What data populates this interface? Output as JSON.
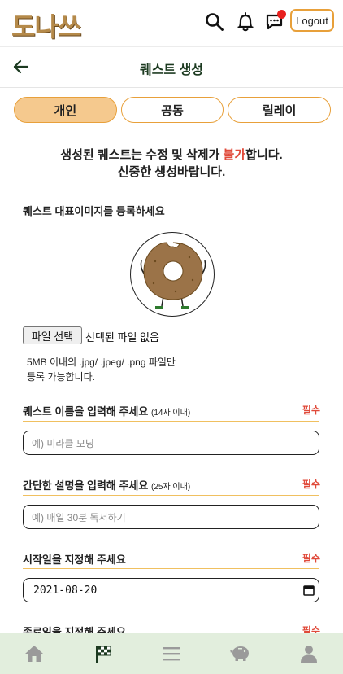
{
  "app": {
    "logo_text": "도나쓰"
  },
  "header": {
    "logout_label": "Logout",
    "icons": [
      "search-icon",
      "bell-icon",
      "chat-icon",
      "chat-notification-dot"
    ]
  },
  "subheader": {
    "title": "퀘스트 생성",
    "back_icon": "back-arrow-icon"
  },
  "tabs": [
    {
      "label": "개인",
      "active": true
    },
    {
      "label": "공동",
      "active": false
    },
    {
      "label": "릴레이",
      "active": false
    }
  ],
  "notice": {
    "line1_before": "생성된 퀘스트는 수정 및 삭제가 ",
    "line1_red": "불가",
    "line1_after": "합니다.",
    "line2": "신중한 생성바랍니다."
  },
  "image_section": {
    "label": "퀘스트 대표이미지를 등록하세요",
    "file_button": "파일 선택",
    "file_status": "선택된 파일 없음",
    "note_line1": "5MB 이내의 .jpg/ .jpeg/ .png 파일만",
    "note_line2": "등록 가능합니다."
  },
  "name_section": {
    "label": "퀘스트 이름을 입력해 주세요",
    "hint": "(14자 이내)",
    "required": "필수",
    "placeholder": "예) 미라클 모닝"
  },
  "desc_section": {
    "label": "간단한 설명을 입력해 주세요",
    "hint": "(25자 이내)",
    "required": "필수",
    "placeholder": "예) 매일 30분 독서하기"
  },
  "start_section": {
    "label": "시작일을 지정해 주세요",
    "required": "필수",
    "value": "2021-08-20"
  },
  "end_section": {
    "label": "종료일을 지정해 주세요",
    "required": "필수"
  },
  "bottom_nav": [
    "home-icon",
    "checkered-flag-icon",
    "menu-icon",
    "piggy-bank-icon",
    "user-icon"
  ],
  "colors": {
    "accent_orange": "#e8a03a",
    "tab_active": "#f5c98e",
    "required_red": "#e04a3a",
    "nav_bg": "#e2eedd"
  }
}
